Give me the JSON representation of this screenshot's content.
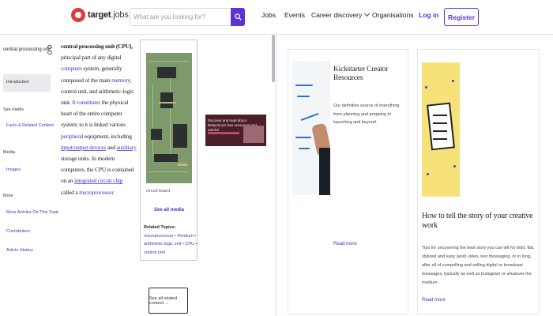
{
  "header": {
    "logo_main": "target",
    "logo_suffix": "jobs",
    "search_placeholder": "What are you looking for?",
    "nav": [
      "Jobs",
      "Events",
      "Career discovery",
      "Organisations"
    ],
    "login_label": "Log in",
    "register_label": "Register",
    "accent_color": "#5b33d6"
  },
  "sidebar": {
    "search_term": "central processing unit",
    "active_item": "Introduction",
    "section_see_more_heading": "See Fields",
    "section_see_more_link": "Facts & Related Content",
    "section_media_heading": "Media",
    "section_media_link": "Images",
    "section_more_heading": "More",
    "more_links": [
      "More Articles On This Topic",
      "Contributors",
      "Article History"
    ]
  },
  "article": {
    "lead_bold": "central processing unit (CPU),",
    "text_1": " principal part of any digital ",
    "link_computer": "computer",
    "text_2": " system, generally composed of the main ",
    "link_memory": "memory",
    "text_3": ", control unit, and arithmetic-logic unit. ",
    "link_constitutes": "It constitutes",
    "text_4": " the physical heart of the entire computer system; to it is linked various ",
    "link_peripheral": "peripheral",
    "text_5": " equipment, including ",
    "link_io": "input/output devices",
    "text_6": " and ",
    "link_auxiliary": "auxiliary",
    "text_7": " storage units. In modern computers, the CPU is contained on an ",
    "link_ic": "integrated circuit chip",
    "text_8": " called a ",
    "link_micro": "microprocessor",
    "text_9": ".",
    "image_caption": "circuit board",
    "see_all_media": "See all media",
    "related_label": "Related Topics:",
    "related_links": "microprocessor • Pentium • arithmetic-logic unit • CPU • control unit",
    "related_button": "See all related content →"
  },
  "banner": {
    "text": "Discover and read about Britannica's free resources and articles"
  },
  "cards": [
    {
      "title": "Kickstarter Creator Resources",
      "desc": "Our definitive source of everything from planning and prepping to launching and beyond.",
      "read_more": "Read more"
    },
    {
      "title": "How to tell the story of your creative work",
      "desc": "Tips for uncovering the best story you can tell for bold, flat, stylized and easy (and) video, text messaging, or in long, after all of compelling and selling digital or broadcast messages, typically as well as Instagram or whatever the medium.",
      "read_more": "Read more"
    }
  ]
}
